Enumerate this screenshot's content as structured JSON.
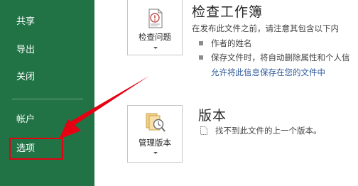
{
  "sidebar": {
    "items": [
      {
        "label": "共享"
      },
      {
        "label": "导出"
      },
      {
        "label": "关闭"
      },
      {
        "label": "帐户"
      },
      {
        "label": "选项"
      }
    ]
  },
  "inspect": {
    "button_label": "检查问题",
    "title": "检查工作簿",
    "description": "在发布此文件之前，请注意其包含以下内",
    "bullets": [
      "作者的姓名",
      "保存文件时，将自动删除属性和个人信"
    ],
    "link": "允许将此信息保存在您的文件中"
  },
  "versions": {
    "button_label": "管理版本",
    "title": "版本",
    "text": "找不到此文件的上一个版本。"
  },
  "colors": {
    "sidebar": "#217346",
    "annotation": "#e60012",
    "link": "#2b579a"
  }
}
